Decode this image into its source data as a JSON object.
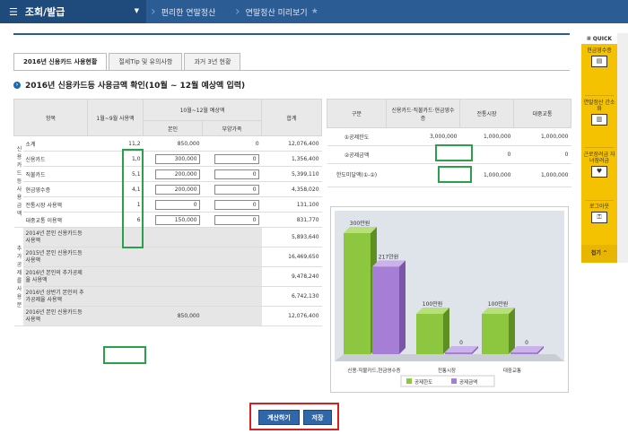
{
  "topbar": {
    "menu_title": "조회/발급",
    "crumbs": [
      "편리한 연말정산",
      "연말정산 미리보기"
    ]
  },
  "tabs": [
    "2016년 신용카드 사용현황",
    "절세Tip 및 유의사항",
    "과거 3년 현황"
  ],
  "section_title": "2016년 신용카드등 사용금액 확인(10월 ~ 12월 예상액 입력)",
  "main_table": {
    "headers": {
      "item": "항목",
      "jan_sep": "1월~9월 사용액",
      "oct_dec": "10월~12월 예상액",
      "self": "본인",
      "dependents": "부양가족",
      "total": "합계"
    },
    "side_label_1": "신용카드등사용금액",
    "side_label_2": "추가공제를사용분",
    "rows": [
      {
        "label": "소계",
        "used": "11,2",
        "self": "850,000",
        "dep": "0",
        "total": "12,076,400"
      },
      {
        "label": "신용카드",
        "used": "1,0",
        "self": "300,000",
        "dep": "0",
        "total": "1,356,400"
      },
      {
        "label": "직불카드",
        "used": "5,1",
        "self": "200,000",
        "dep": "0",
        "total": "5,399,110"
      },
      {
        "label": "현금영수증",
        "used": "4,1",
        "self": "200,000",
        "dep": "0",
        "total": "4,358,020"
      },
      {
        "label": "전통시장 사용액",
        "used": "1",
        "self": "0",
        "dep": "0",
        "total": "131,100"
      },
      {
        "label": "대중교통 이용액",
        "used": "6",
        "self": "150,000",
        "dep": "0",
        "total": "831,770"
      }
    ],
    "extra_rows": [
      {
        "label": "2014년 본인 신용카드등 사용액",
        "total": "5,893,640"
      },
      {
        "label": "2015년 본인 신용카드등 사용액",
        "total": "16,469,650"
      },
      {
        "label": "2016년 본인의 추가공제율 사용액",
        "total": "9,478,240"
      },
      {
        "label": "2016년 상반기 본인의 추가공제율 사용액",
        "total": "6,742,130"
      },
      {
        "label": "2016년 본인 신용카드등 사용액",
        "self": "850,000",
        "total": "12,076,400"
      }
    ]
  },
  "right_table": {
    "headers": {
      "kind": "구분",
      "credit": "신용카드·직불카드·현금영수증",
      "market": "전통시장",
      "transit": "대중교통"
    },
    "rows": [
      {
        "label": "①공제한도",
        "credit": "3,000,000",
        "market": "1,000,000",
        "transit": "1,000,000"
      },
      {
        "label": "②공제금액",
        "credit": "",
        "market": "0",
        "transit": "0"
      },
      {
        "label": "한도미달액(①-②)",
        "credit": "",
        "market": "1,000,000",
        "transit": "1,000,000"
      }
    ]
  },
  "chart_data": {
    "type": "bar",
    "categories": [
      "신용·직불카드,현금영수증",
      "전통시장",
      "대중교통"
    ],
    "series": [
      {
        "name": "공제한도",
        "values": [
          300,
          100,
          100
        ],
        "labels": [
          "300만원",
          "100만원",
          "100만원"
        ],
        "color": "#8dc63f"
      },
      {
        "name": "공제금액",
        "values": [
          217,
          0,
          0
        ],
        "labels": [
          "217만원",
          "0",
          "0"
        ],
        "color": "#a77ed6"
      }
    ],
    "ylim": [
      0,
      320
    ]
  },
  "buttons": {
    "calc": "계산하기",
    "save": "저장"
  },
  "quick": {
    "title": "QUICK",
    "items": [
      "현금영수증",
      "연말정산 간소화",
      "근로장려금 자녀장려금",
      "로그아웃"
    ],
    "top": "접기"
  }
}
